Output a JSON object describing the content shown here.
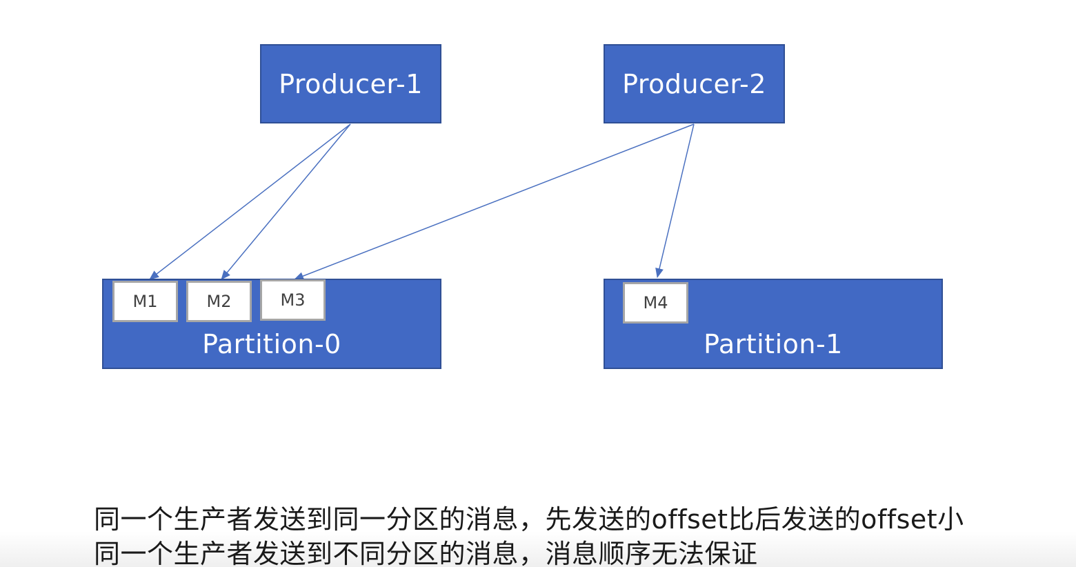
{
  "producers": [
    {
      "label": "Producer-1"
    },
    {
      "label": "Producer-2"
    }
  ],
  "partitions": [
    {
      "label": "Partition-0",
      "messages": [
        "M1",
        "M2",
        "M3"
      ]
    },
    {
      "label": "Partition-1",
      "messages": [
        "M4"
      ]
    }
  ],
  "flows": [
    {
      "from": "Producer-1",
      "to": "M1"
    },
    {
      "from": "Producer-1",
      "to": "M2"
    },
    {
      "from": "Producer-2",
      "to": "M3"
    },
    {
      "from": "Producer-2",
      "to": "M4"
    }
  ],
  "captions": [
    "同一个生产者发送到同一分区的消息，先发送的offset比后发送的offset小",
    "同一个生产者发送到不同分区的消息，消息顺序无法保证"
  ],
  "colors": {
    "box_fill": "#4169c4",
    "box_border": "#2f4f95",
    "message_fill": "#ffffff",
    "message_border": "#a6a6a6",
    "arrow": "#4a70c0"
  }
}
